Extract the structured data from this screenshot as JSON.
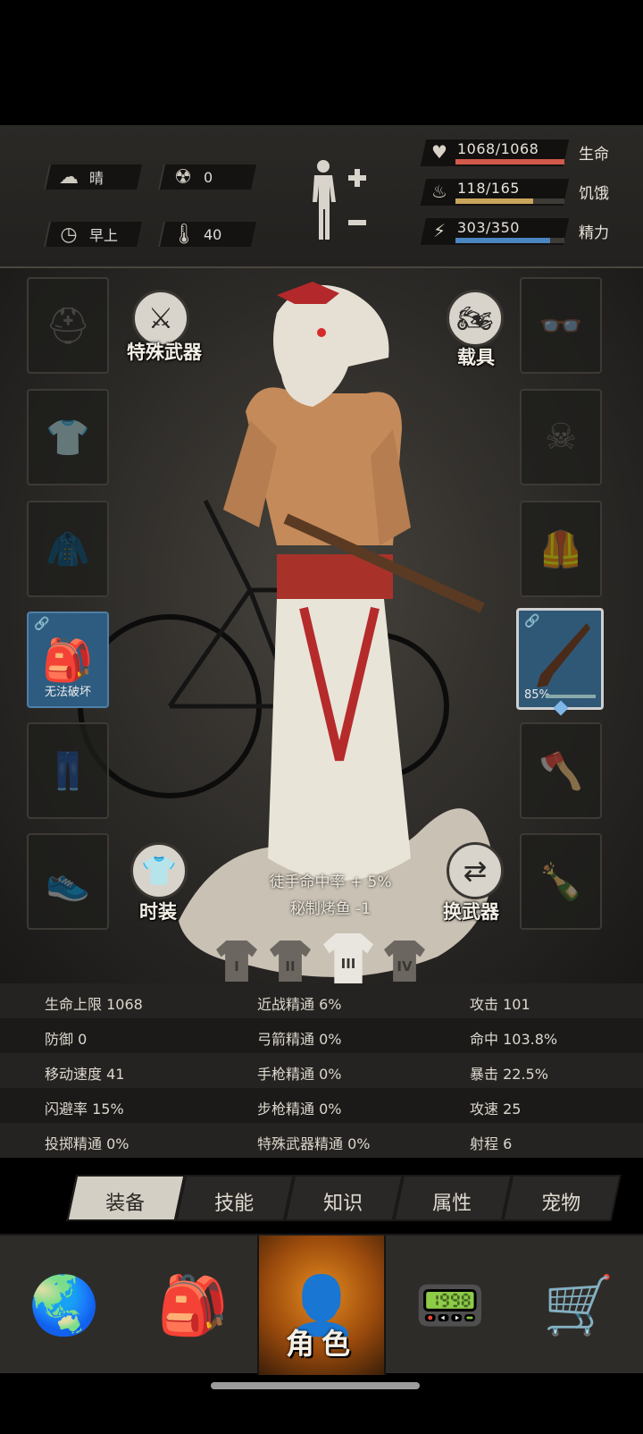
{
  "status": {
    "weather": {
      "icon": "cloud-sun-icon",
      "value": "晴"
    },
    "radiation": {
      "icon": "radiation-icon",
      "value": "0"
    },
    "time_of_day": {
      "icon": "clock-icon",
      "value": "早上"
    },
    "temperature": {
      "icon": "thermometer-icon",
      "value": "40"
    }
  },
  "vitals": [
    {
      "key": "life",
      "icon": "heart-icon",
      "text": "1068/1068",
      "label": "生命",
      "fraction": 1.0,
      "color": "#d25a4a"
    },
    {
      "key": "hunger",
      "icon": "stomach-icon",
      "text": "118/165",
      "label": "饥饿",
      "fraction": 0.715,
      "color": "#c8a45c"
    },
    {
      "key": "energy",
      "icon": "lightning-icon",
      "text": "303/350",
      "label": "精力",
      "fraction": 0.866,
      "color": "#4a86c0"
    }
  ],
  "round_buttons": {
    "special_weapon": "特殊武器",
    "vehicle": "载具",
    "fashion": "时装",
    "switch_weapon": "换武器"
  },
  "slots": {
    "backpack_caption": "无法破坏",
    "rifle_durability": "85%"
  },
  "buffs": [
    "徒手命中率 + 5%",
    "秘制烤鱼 -1"
  ],
  "outfit_tabs": [
    "I",
    "II",
    "III",
    "IV"
  ],
  "outfit_active": 2,
  "stats": [
    [
      "生命上限 1068",
      "近战精通 6%",
      "攻击 101"
    ],
    [
      "防御 0",
      "弓箭精通 0%",
      "命中 103.8%"
    ],
    [
      "移动速度 41",
      "手枪精通 0%",
      "暴击 22.5%"
    ],
    [
      "闪避率 15%",
      "步枪精通 0%",
      "攻速 25"
    ],
    [
      "投掷精通 0%",
      "特殊武器精通 0%",
      "射程 6"
    ]
  ],
  "tabs": [
    "装备",
    "技能",
    "知识",
    "属性",
    "宠物"
  ],
  "tab_active": 0,
  "bottom_nav": [
    {
      "icon": "globe-icon"
    },
    {
      "icon": "backpack-icon"
    },
    {
      "icon": "character-icon",
      "label": "角色"
    },
    {
      "icon": "walkie-talkie-icon"
    },
    {
      "icon": "shopping-cart-icon"
    }
  ],
  "nav_active": 2
}
